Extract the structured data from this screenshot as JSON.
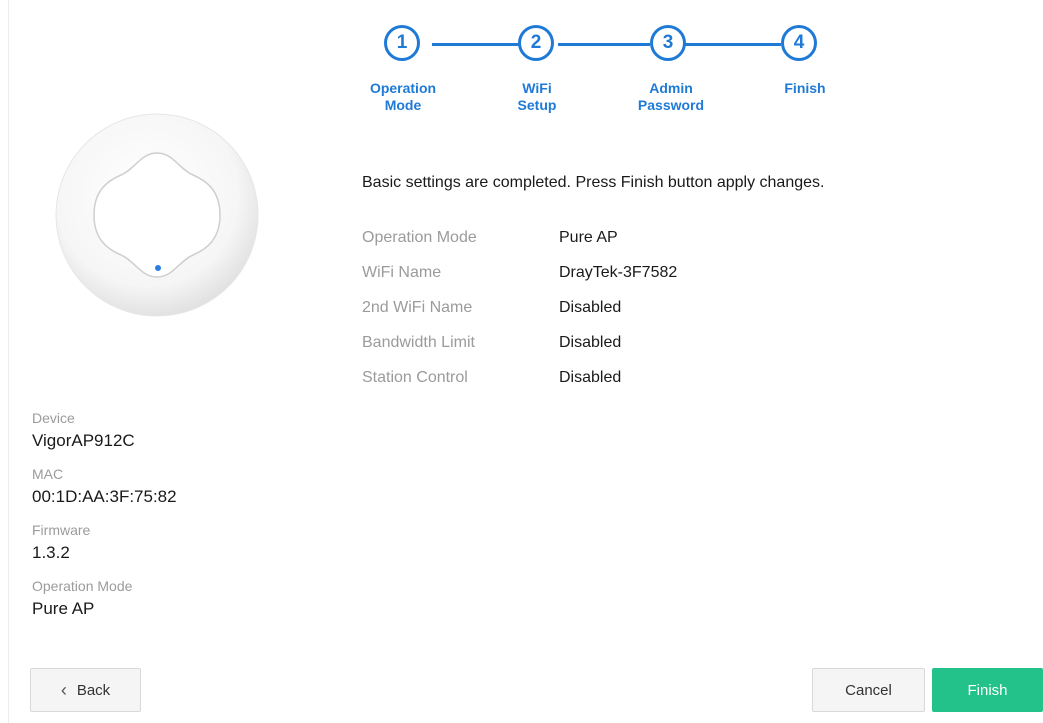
{
  "stepper": {
    "steps": [
      {
        "number": "1",
        "line1": "Operation",
        "line2": "Mode"
      },
      {
        "number": "2",
        "line1": "WiFi",
        "line2": "Setup"
      },
      {
        "number": "3",
        "line1": "Admin",
        "line2": "Password"
      },
      {
        "number": "4",
        "line1": "Finish",
        "line2": ""
      }
    ],
    "accent_color": "#1f7ad6"
  },
  "summary": {
    "message": "Basic settings are completed. Press Finish button apply changes.",
    "rows": [
      {
        "key": "Operation Mode",
        "value": "Pure AP"
      },
      {
        "key": "WiFi Name",
        "value": "DrayTek-3F7582"
      },
      {
        "key": "2nd WiFi Name",
        "value": "Disabled"
      },
      {
        "key": "Bandwidth Limit",
        "value": "Disabled"
      },
      {
        "key": "Station Control",
        "value": "Disabled"
      }
    ]
  },
  "device": {
    "image_icon": "access-point-device-image",
    "fields": [
      {
        "label": "Device",
        "value": "VigorAP912C"
      },
      {
        "label": "MAC",
        "value": "00:1D:AA:3F:75:82"
      },
      {
        "label": "Firmware",
        "value": "1.3.2"
      },
      {
        "label": "Operation Mode",
        "value": "Pure AP"
      }
    ]
  },
  "buttons": {
    "back_label": "Back",
    "cancel_label": "Cancel",
    "finish_label": "Finish",
    "finish_color": "#23c28a"
  }
}
